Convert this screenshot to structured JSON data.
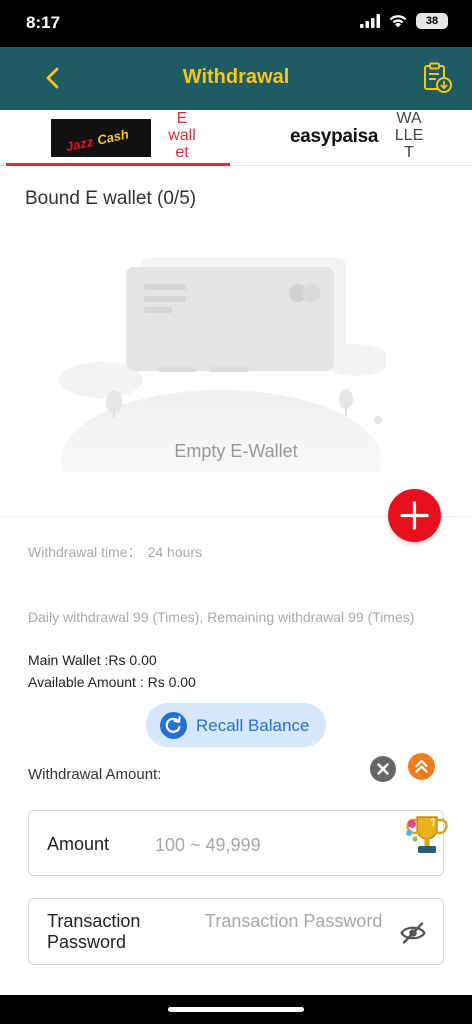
{
  "status_bar": {
    "time": "8:17",
    "battery": "38"
  },
  "header": {
    "title": "Withdrawal"
  },
  "tabs": [
    {
      "logo_text": "JazzCash",
      "label": "E wall et"
    },
    {
      "logo_text": "easypaisa",
      "label": "WA LLE T"
    }
  ],
  "wallet": {
    "bound_title": "Bound E wallet (0/5)",
    "empty_label": "Empty E-Wallet"
  },
  "info": {
    "withdrawal_time_label": "Withdrawal time：",
    "withdrawal_time_value": "24 hours",
    "daily_limit": "Daily withdrawal 99 (Times), Remaining withdrawal 99 (Times)",
    "main_wallet": "Main Wallet :Rs 0.00",
    "available_amount": "Available Amount : Rs 0.00"
  },
  "recall": {
    "label": "Recall Balance"
  },
  "form": {
    "withdrawal_amount_label": "Withdrawal Amount:",
    "amount_label": "Amount",
    "amount_placeholder": "100 ~ 49,999",
    "password_label": "Transaction Password",
    "password_placeholder": "Transaction Password"
  },
  "colors": {
    "header_bg": "#1f5b63",
    "header_title": "#f5c518",
    "accent_red": "#e8101d",
    "recall_blue": "#2471d6"
  },
  "icons": {
    "back": "chevron-left-icon",
    "records": "clipboard-download-icon",
    "add": "plus-icon",
    "recall": "refresh-icon",
    "clear": "close-icon",
    "up": "double-chevron-up-icon",
    "trophy": "trophy-icon",
    "eye": "eye-off-icon"
  }
}
